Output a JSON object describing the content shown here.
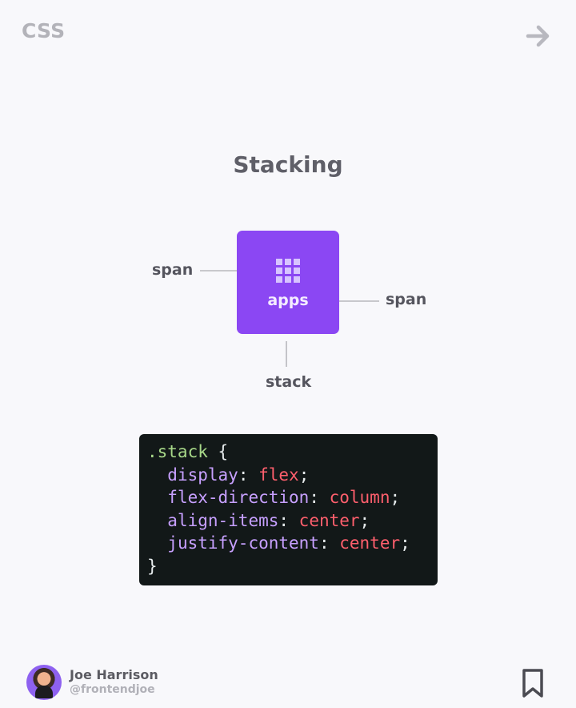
{
  "header": {
    "category": "CSS",
    "next_icon": "arrow-right-icon"
  },
  "diagram": {
    "title": "Stacking",
    "box": {
      "icon": "grid-icon",
      "label": "apps",
      "color": "#8b47f3"
    },
    "callouts": {
      "left_span": "span",
      "right_span": "span",
      "stack": "stack"
    }
  },
  "code": {
    "selector": ".stack",
    "open_brace": "{",
    "close_brace": "}",
    "declarations": [
      {
        "property": "display",
        "value": "flex"
      },
      {
        "property": "flex-direction",
        "value": "column"
      },
      {
        "property": "align-items",
        "value": "center"
      },
      {
        "property": "justify-content",
        "value": "center"
      }
    ]
  },
  "footer": {
    "author_name": "Joe Harrison",
    "author_handle": "@frontendjoe",
    "bookmark_icon": "bookmark-icon"
  }
}
